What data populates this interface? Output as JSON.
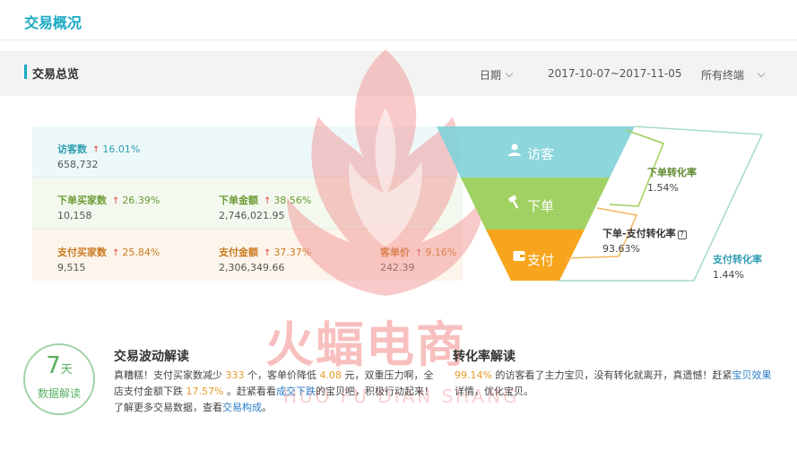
{
  "page": {
    "title": "交易概况"
  },
  "overview": {
    "title": "交易总览",
    "date_label": "日期",
    "date_range": "2017-10-07~2017-11-05",
    "terminal": "所有终端"
  },
  "metrics": {
    "visitors": {
      "label": "访客数",
      "arrow": "↑",
      "pct": "16.01%",
      "value": "658,732"
    },
    "order_buyers": {
      "label": "下单买家数",
      "arrow": "↑",
      "pct": "26.39%",
      "value": "10,158"
    },
    "order_amount": {
      "label": "下单金额",
      "arrow": "↑",
      "pct": "38.56%",
      "value": "2,746,021.95"
    },
    "pay_buyers": {
      "label": "支付买家数",
      "arrow": "↑",
      "pct": "25.84%",
      "value": "9,515"
    },
    "pay_amount": {
      "label": "支付金额",
      "arrow": "↑",
      "pct": "37.37%",
      "value": "2,306,349.66"
    },
    "unit_price": {
      "label": "客单价",
      "arrow": "↑",
      "pct": "9.16%",
      "value": "242.39"
    }
  },
  "funnel": {
    "visit": "访客",
    "order": "下单",
    "pay": "支付",
    "colors": {
      "visit": "#7fd2d8",
      "order": "#9ccf5b",
      "pay": "#f7a51c"
    }
  },
  "rates": {
    "order_rate": {
      "label": "下单转化率",
      "value": "1.54%"
    },
    "order_pay_rate": {
      "label": "下单-支付转化率",
      "help": "?",
      "value": "93.63%"
    },
    "pay_rate": {
      "label": "支付转化率",
      "value": "1.44%"
    }
  },
  "badge": {
    "number": "7",
    "unit": "天",
    "text": "数据解读"
  },
  "fluctuation": {
    "title": "交易波动解读",
    "line1": {
      "a": "真糟糕！支付买家数减少",
      "n1": "333",
      "b": "个，客单价降低",
      "n2": "4.08",
      "c": "元，双重压力啊，全"
    },
    "line2": {
      "a": "店支付金额下跌",
      "n1": "17.57%",
      "b": "。赶紧看看",
      "link": "成交下跌",
      "c": "的宝贝吧，积极行动起来！"
    },
    "line3": {
      "a": "了解更多交易数据，查看",
      "link": "交易构成",
      "b": "。"
    }
  },
  "conversion": {
    "title": "转化率解读",
    "line1": {
      "n1": "99.14%",
      "a": "的访客看了主力宝贝，没有转化就离开，真遗憾！赶紧",
      "link": "宝贝效果"
    },
    "line2": {
      "a": "详情，优化宝贝。"
    }
  },
  "watermark": {
    "main": "火蝠电商",
    "sub": "HUO FU DIAN SHANG"
  }
}
